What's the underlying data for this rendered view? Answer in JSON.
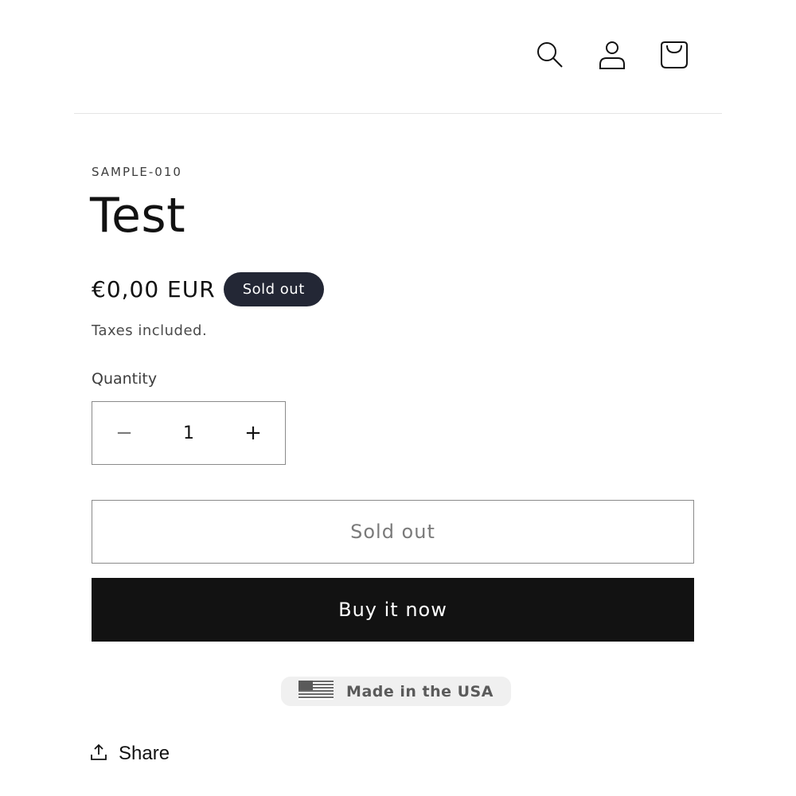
{
  "header": {
    "icons": [
      "search-icon",
      "account-icon",
      "cart-icon"
    ]
  },
  "product": {
    "sku": "SAMPLE-010",
    "title": "Test",
    "price": "€0,00 EUR",
    "badge": "Sold out",
    "taxes_note": "Taxes included.",
    "quantity_label": "Quantity",
    "quantity_value": "1",
    "minus_symbol": "−",
    "plus_symbol": "+"
  },
  "actions": {
    "add_to_cart_label": "Sold out",
    "buy_now_label": "Buy it now"
  },
  "badge_usa": {
    "text": "Made in the USA",
    "icon": "us-flag-icon"
  },
  "share": {
    "label": "Share",
    "icon": "share-icon"
  },
  "colors": {
    "badge_bg": "#232735",
    "buy_button_bg": "#121212",
    "usa_badge_bg": "#f0f0f0"
  }
}
